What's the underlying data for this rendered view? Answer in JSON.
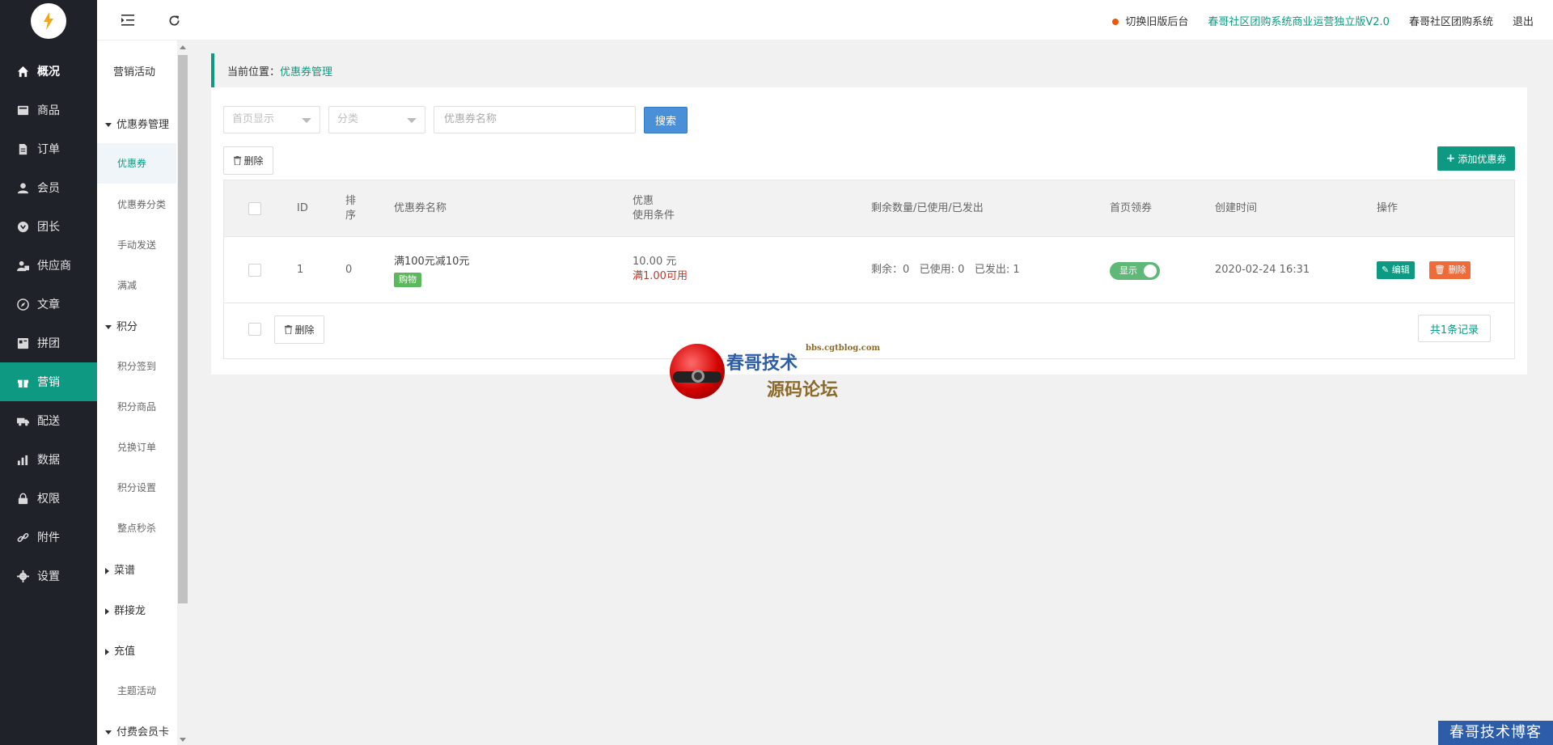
{
  "nav": {
    "items": [
      {
        "label": "概况",
        "icon": "home-icon"
      },
      {
        "label": "商品",
        "icon": "goods-icon"
      },
      {
        "label": "订单",
        "icon": "order-icon"
      },
      {
        "label": "会员",
        "icon": "member-icon"
      },
      {
        "label": "团长",
        "icon": "leader-icon"
      },
      {
        "label": "供应商",
        "icon": "supplier-icon"
      },
      {
        "label": "文章",
        "icon": "article-icon"
      },
      {
        "label": "拼团",
        "icon": "group-buy-icon"
      },
      {
        "label": "营销",
        "icon": "gift-icon"
      },
      {
        "label": "配送",
        "icon": "truck-icon"
      },
      {
        "label": "数据",
        "icon": "chart-icon"
      },
      {
        "label": "权限",
        "icon": "lock-icon"
      },
      {
        "label": "附件",
        "icon": "link-icon"
      },
      {
        "label": "设置",
        "icon": "gear-icon"
      }
    ],
    "active": "营销"
  },
  "subnav": {
    "title": "营销活动",
    "groups": {
      "coupon_manage": "优惠券管理",
      "coupon": "优惠券",
      "coupon_category": "优惠券分类",
      "manual_send": "手动发送",
      "full_reduce": "满减",
      "points": "积分",
      "points_checkin": "积分签到",
      "points_goods": "积分商品",
      "exchange_orders": "兑换订单",
      "points_settings": "积分设置",
      "flash_sale": "整点秒杀",
      "recipes": "菜谱",
      "group_chain": "群接龙",
      "recharge": "充值",
      "theme_activity": "主题活动",
      "paid_member_card": "付费会员卡"
    }
  },
  "header": {
    "switch_old": "切换旧版后台",
    "version_link": "春哥社区团购系统商业运营独立版V2.0",
    "system_name": "春哥社区团购系统",
    "logout": "退出"
  },
  "breadcrumb": {
    "prefix": "当前位置：",
    "current": "优惠券管理"
  },
  "filters": {
    "homepage_display_placeholder": "首页显示",
    "category_placeholder": "分类",
    "coupon_name_placeholder": "优惠券名称",
    "search_label": "搜索"
  },
  "actions": {
    "delete_label": "删除",
    "add_coupon_label": "添加优惠券",
    "total_records": "共1条记录"
  },
  "table": {
    "headers": {
      "id": "ID",
      "sort_line1": "排",
      "sort_line2": "序",
      "name": "优惠券名称",
      "discount_line1": "优惠",
      "discount_line2": "使用条件",
      "quantity": "剩余数量/已使用/已发出",
      "homepage": "首页领券",
      "created": "创建时间",
      "ops": "操作"
    },
    "rows": [
      {
        "id": "1",
        "sort": "0",
        "name": "满100元减10元",
        "tag": "购物",
        "discount": "10.00 元",
        "condition": "满1.00可用",
        "quantity": "剩余：0   已使用: 0   已发出: 1",
        "homepage_switch": "显示",
        "created": "2020-02-24 16:31",
        "edit_label": "编辑",
        "delete_label": "删除"
      }
    ]
  },
  "watermark": {
    "title": "春哥技术",
    "subtitle": "源码论坛",
    "url": "bbs.cgtblog.com",
    "corner": "春哥技术博客"
  },
  "colors": {
    "primary": "#0e9a82",
    "nav_bg": "#20222a",
    "search_blue": "#4a90d9",
    "delete_orange": "#ee6c3a"
  }
}
